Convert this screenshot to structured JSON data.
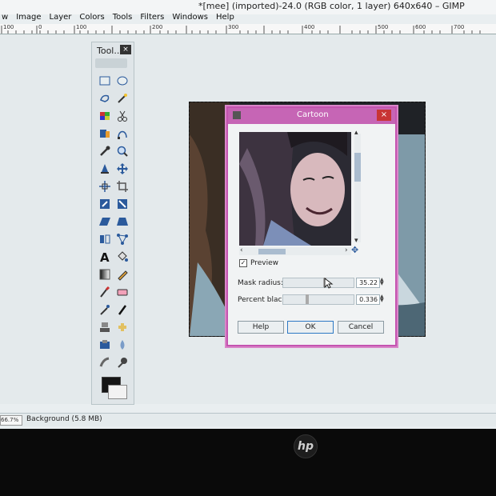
{
  "window": {
    "title": "*[mee] (imported)-24.0 (RGB color, 1 layer) 640x640 – GIMP"
  },
  "menu": [
    "w",
    "Image",
    "Layer",
    "Colors",
    "Tools",
    "Filters",
    "Windows",
    "Help"
  ],
  "ruler": {
    "labels": [
      "100",
      "0",
      "100",
      "200",
      "300",
      "400",
      "500",
      "600",
      "700"
    ]
  },
  "toolbox": {
    "title": "Tool...",
    "close": "×"
  },
  "dialog": {
    "title": "Cartoon",
    "close": "×",
    "preview_label": "Preview",
    "preview_checked": "✓",
    "mask_radius_label": "Mask radius:",
    "mask_radius_value": "35.22",
    "percent_black_label": "Percent black:",
    "percent_black_value": "0.336",
    "buttons": {
      "help": "Help",
      "ok": "OK",
      "cancel": "Cancel"
    }
  },
  "status": {
    "zoom": "66.7%",
    "layer": "Background (5.8 MB)"
  },
  "bezel": {
    "brand": "hp"
  },
  "colors": {
    "dialog_accent": "#c665b5",
    "close_red": "#c83434"
  }
}
